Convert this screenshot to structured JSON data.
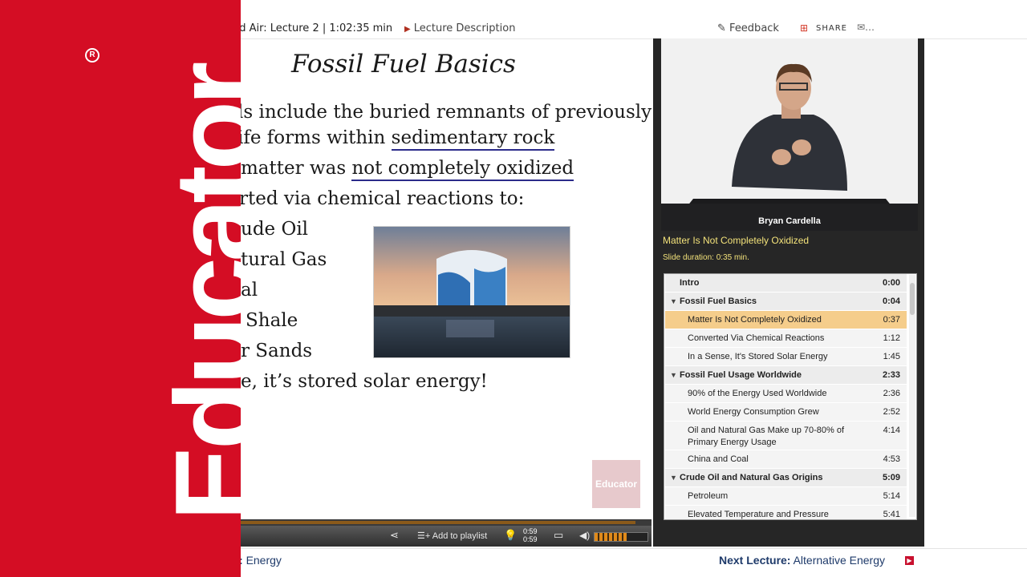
{
  "header": {
    "lecture_title": "nd Air: Lecture 2 | 1:02:35 min",
    "description_link": "Lecture Description",
    "feedback": "Feedback",
    "share": "SHARE"
  },
  "slide": {
    "title": "Fossil Fuel Basics",
    "lines": [
      "ls include the buried remnants of previously",
      "ife forms within",
      "sedimentary rock",
      "matter was",
      "not completely oxidized",
      "rted via chemical reactions to:",
      "ude Oil",
      "tural Gas",
      "al",
      "Shale",
      "r Sands",
      "e, it’s stored solar energy!"
    ],
    "watermark": "Educator"
  },
  "player": {
    "progress_fraction": 0.96,
    "add_to_playlist": "Add to playlist",
    "time_current": "0:59",
    "time_total": "0:59",
    "volume_fraction": 0.6
  },
  "presenter": {
    "name": "Bryan Cardella",
    "current_slide": "Matter Is Not Completely Oxidized",
    "slide_duration": "Slide duration: 0:35 min."
  },
  "toc": [
    {
      "label": "Intro",
      "time": "0:00",
      "kind": "sec",
      "tri": false
    },
    {
      "label": "Fossil Fuel Basics",
      "time": "0:04",
      "kind": "sec",
      "tri": true
    },
    {
      "label": "Matter Is Not Completely Oxidized",
      "time": "0:37",
      "kind": "active"
    },
    {
      "label": "Converted Via Chemical Reactions",
      "time": "1:12",
      "kind": "sub"
    },
    {
      "label": "In a Sense, It's Stored Solar Energy",
      "time": "1:45",
      "kind": "sub"
    },
    {
      "label": "Fossil Fuel Usage Worldwide",
      "time": "2:33",
      "kind": "sec",
      "tri": true
    },
    {
      "label": "90% of the Energy Used Worldwide",
      "time": "2:36",
      "kind": "sub"
    },
    {
      "label": "World Energy Consumption Grew",
      "time": "2:52",
      "kind": "sub"
    },
    {
      "label": "Oil and Natural Gas Make up 70-80% of Primary Energy Usage",
      "time": "4:14",
      "kind": "sub"
    },
    {
      "label": "China and Coal",
      "time": "4:53",
      "kind": "sub"
    },
    {
      "label": "Crude Oil and Natural Gas Origins",
      "time": "5:09",
      "kind": "sec",
      "tri": true
    },
    {
      "label": "Petroleum",
      "time": "5:14",
      "kind": "sub"
    },
    {
      "label": "Elevated Temperature and Pressure Facilitate",
      "time": "5:41",
      "kind": "sub"
    }
  ],
  "footer": {
    "prev_prefix": ":",
    "prev_title": "Energy",
    "next_prefix": "Next Lecture:",
    "next_title": "Alternative Energy"
  },
  "brand": {
    "logo": "Educator",
    "registered": "R"
  },
  "colors": {
    "brand_red": "#d40d24",
    "active_row": "#f5cd8b",
    "slide_caption": "#f3e27a",
    "link_blue": "#1e3a6a"
  }
}
